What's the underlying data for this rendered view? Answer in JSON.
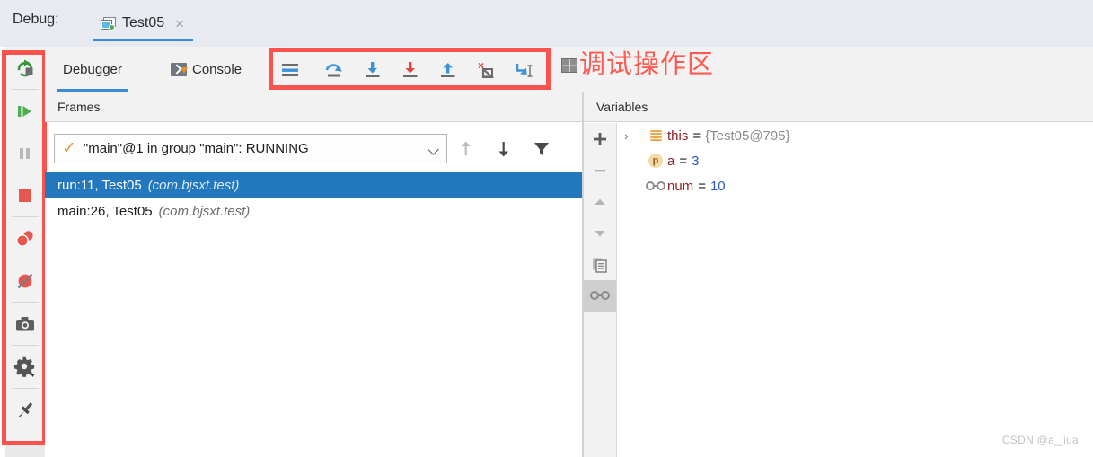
{
  "topbar": {
    "debug_label": "Debug:",
    "run_tab": {
      "title": "Test05",
      "close": "×",
      "icon": "run-config-window-icon"
    }
  },
  "left_toolbar": {
    "buttons": [
      {
        "name": "rerun-button",
        "tooltip": "Rerun"
      },
      {
        "name": "resume-program-button",
        "tooltip": "Resume Program"
      },
      {
        "name": "pause-program-button",
        "tooltip": "Pause Program"
      },
      {
        "name": "stop-button",
        "tooltip": "Stop"
      },
      {
        "name": "view-breakpoints-button",
        "tooltip": "View Breakpoints"
      },
      {
        "name": "mute-breakpoints-button",
        "tooltip": "Mute Breakpoints"
      },
      {
        "name": "get-thread-dump-button",
        "tooltip": "Get Thread Dump"
      },
      {
        "name": "settings-button",
        "tooltip": "Settings"
      },
      {
        "name": "pin-tab-button",
        "tooltip": "Pin Tab"
      }
    ]
  },
  "tabs": [
    {
      "label": "Debugger",
      "active": true,
      "icon": ""
    },
    {
      "label": "Console",
      "active": false,
      "icon": "console-icon"
    }
  ],
  "step_toolbar": {
    "buttons": [
      {
        "name": "show-execution-point-button",
        "tooltip": "Show Execution Point"
      },
      {
        "name": "step-over-button",
        "tooltip": "Step Over"
      },
      {
        "name": "step-into-button",
        "tooltip": "Step Into"
      },
      {
        "name": "force-step-into-button",
        "tooltip": "Force Step Into"
      },
      {
        "name": "step-out-button",
        "tooltip": "Step Out"
      },
      {
        "name": "drop-frame-button",
        "tooltip": "Drop Frame"
      },
      {
        "name": "run-to-cursor-button",
        "tooltip": "Run to Cursor"
      }
    ]
  },
  "annotation": {
    "text": "调试操作区",
    "color": "#fc5a52",
    "icon": "grid-icon"
  },
  "frames_panel": {
    "header": "Frames",
    "thread_selector": {
      "value": "\"main\"@1 in group \"main\": RUNNING",
      "status_icon": "check-icon",
      "chevron": "chevron-down-icon"
    },
    "toolbar": [
      {
        "name": "frames-up-button",
        "icon": "arrow-up-icon"
      },
      {
        "name": "frames-down-button",
        "icon": "arrow-down-icon"
      },
      {
        "name": "frames-filter-button",
        "icon": "filter-icon"
      }
    ],
    "rows": [
      {
        "method": "run:11, Test05",
        "package": "(com.bjsxt.test)",
        "selected": true
      },
      {
        "method": "main:26, Test05",
        "package": "(com.bjsxt.test)",
        "selected": false
      }
    ]
  },
  "variables_panel": {
    "header": "Variables",
    "toolbar": [
      {
        "name": "add-watch-button",
        "glyph": "+",
        "icon": "plus-icon",
        "active": false
      },
      {
        "name": "remove-watch-button",
        "glyph": "–",
        "icon": "minus-icon",
        "active": false
      },
      {
        "name": "move-watch-up-button",
        "glyph": "",
        "icon": "triangle-up-icon",
        "active": false
      },
      {
        "name": "move-watch-down-button",
        "glyph": "",
        "icon": "triangle-down-icon",
        "active": false
      },
      {
        "name": "copy-value-button",
        "glyph": "",
        "icon": "copy-icon",
        "active": false
      },
      {
        "name": "watches-toggle-button",
        "glyph": "",
        "icon": "glasses-icon",
        "active": true
      }
    ],
    "rows": [
      {
        "expander": "›",
        "icon": "object-lines-icon",
        "name": "this",
        "eq": "=",
        "value": "{Test05@795}",
        "value_kind": "obj"
      },
      {
        "expander": "",
        "icon": "field-p-icon",
        "name": "a",
        "eq": "=",
        "value": "3",
        "value_kind": "num"
      },
      {
        "expander": "",
        "icon": "glasses-icon",
        "name": "num",
        "eq": "=",
        "value": "10",
        "value_kind": "num"
      }
    ]
  },
  "watermark": "CSDN @a_jiua"
}
